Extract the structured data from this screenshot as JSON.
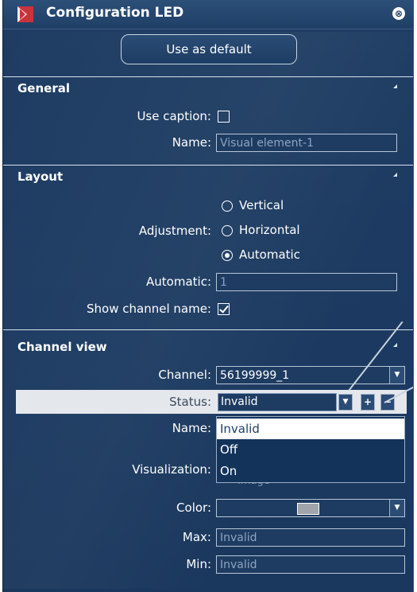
{
  "window": {
    "title": "Configuration LED",
    "close_glyph": "⊗",
    "icon": "red-flag-icon"
  },
  "default_button": "Use as default",
  "general": {
    "title": "General",
    "use_caption_label": "Use caption:",
    "use_caption_checked": false,
    "name_label": "Name:",
    "name_value": "Visual element-1"
  },
  "layout": {
    "title": "Layout",
    "adjustment_label": "Adjustment:",
    "options": [
      "Vertical",
      "Horizontal",
      "Automatic"
    ],
    "selected": "Automatic",
    "automatic_label": "Automatic:",
    "automatic_value": "1",
    "show_channel_label": "Show channel name:",
    "show_channel_checked": true
  },
  "channel_view": {
    "title": "Channel view",
    "channel_label": "Channel:",
    "channel_value": "56199999_1",
    "status_label": "Status:",
    "status_value": "Invalid",
    "status_options": [
      "Invalid",
      "Off",
      "On"
    ],
    "name_label": "Name:",
    "visualization_label": "Visualization:",
    "hidden_option_fragment": "Image",
    "color_label": "Color:",
    "color_value": "#a1a4a8",
    "max_label": "Max:",
    "max_value": "Invalid",
    "min_label": "Min:",
    "min_value": "Invalid",
    "add_glyph": "+",
    "remove_glyph": "−",
    "dropdown_glyph": "▼"
  }
}
